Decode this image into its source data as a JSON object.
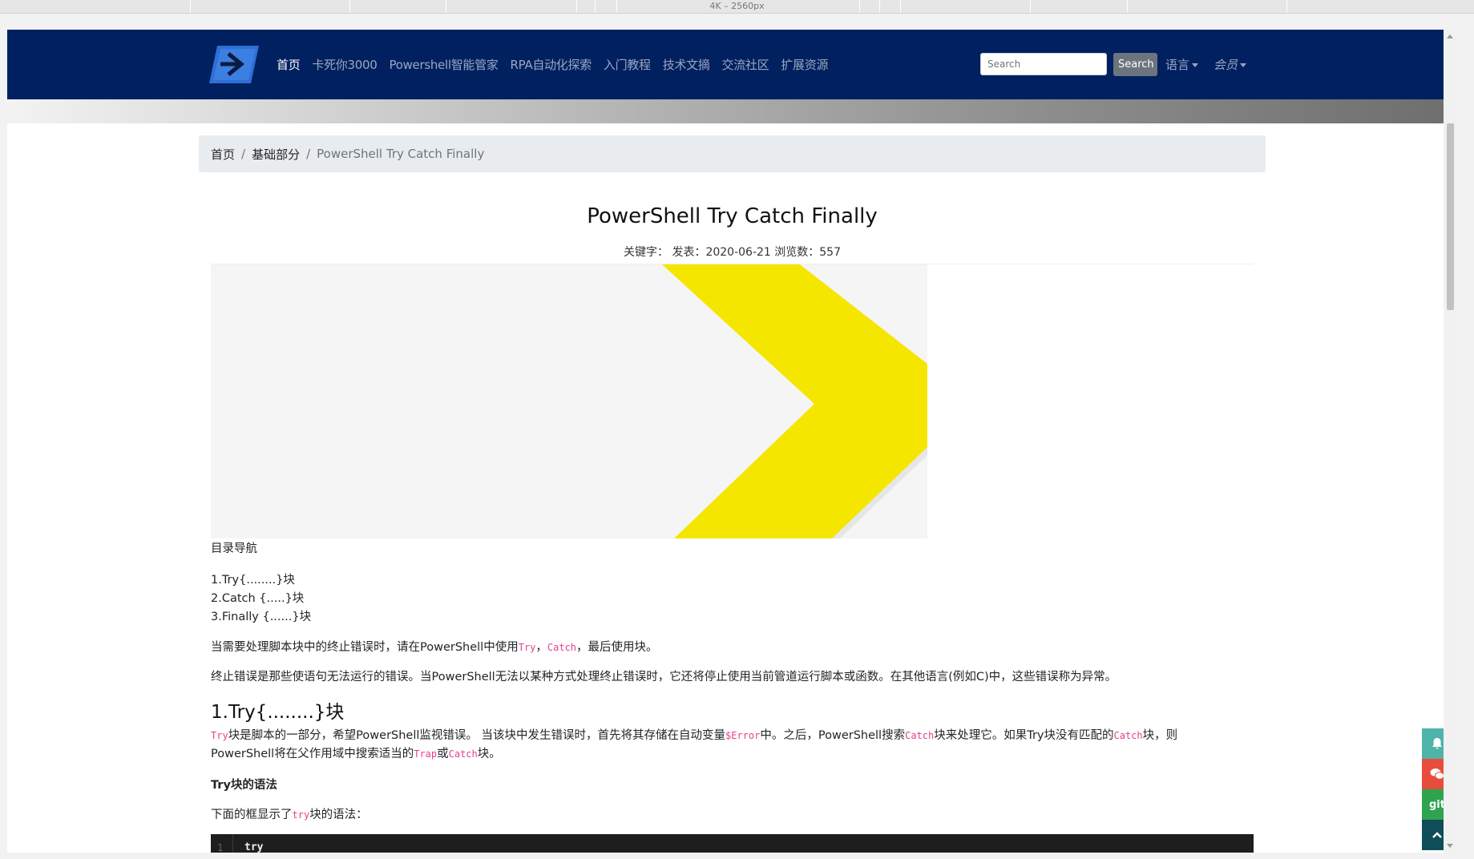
{
  "ruler": {
    "label": "4K – 2560px"
  },
  "navbar": {
    "links": [
      "首页",
      "卡死你3000",
      "Powershell智能管家",
      "RPA自动化探索",
      "入门教程",
      "技术文摘",
      "交流社区",
      "扩展资源"
    ],
    "search_placeholder": "Search",
    "search_button": "Search",
    "language": "语言",
    "member": "会员"
  },
  "breadcrumb": {
    "home": "首页",
    "section": "基础部分",
    "current": "PowerShell Try Catch Finally"
  },
  "article": {
    "title": "PowerShell Try Catch Finally",
    "meta": "关键字：  发表：2020-06-21 浏览数：557",
    "toc_title": "目录导航",
    "toc": [
      "1.Try{........}块",
      "2.Catch {.....}块",
      "3.Finally {......}块"
    ],
    "p1_a": "当需要处理脚本块中的终止错误时，请在PowerShell中使用",
    "p1_try": "Try",
    "p1_b": "，",
    "p1_catch": "Catch",
    "p1_c": "，最后使用块。",
    "p2": "终止错误是那些使语句无法运行的错误。当PowerShell无法以某种方式处理终止错误时，它还将停止使用当前管道运行脚本或函数。在其他语言(例如C)中，这些错误称为异常。",
    "h2": "1.Try{........}块",
    "p3_try": "Try",
    "p3_a": "块是脚本的一部分，希望PowerShell监视错误。 当该块中发生错误时，首先将其存储在自动变量",
    "p3_err": "$Error",
    "p3_b": "中。之后，PowerShell搜索",
    "p3_catch": "Catch",
    "p3_c": "块来处理它。如果Try块没有匹配的",
    "p3_catch2": "Catch",
    "p3_d": "块，则",
    "p3_e": "PowerShell将在父作用域中搜索适当的",
    "p3_trap": "Trap",
    "p3_f": "或",
    "p3_catch3": "Catch",
    "p3_g": "块。",
    "syntax_heading": "Try块的语法",
    "p4_a": "下面的框显示了",
    "p4_try": "try",
    "p4_b": "块的语法：",
    "code_line_no": "1",
    "code_line": "try"
  },
  "side_buttons": [
    {
      "name": "bell-icon",
      "color": "#4fb3a9"
    },
    {
      "name": "wechat-icon",
      "color": "#e74c3c"
    },
    {
      "name": "git-icon",
      "label": "git",
      "color": "#2ea44f"
    },
    {
      "name": "arrow-up-icon",
      "color": "#0e4d59"
    }
  ]
}
